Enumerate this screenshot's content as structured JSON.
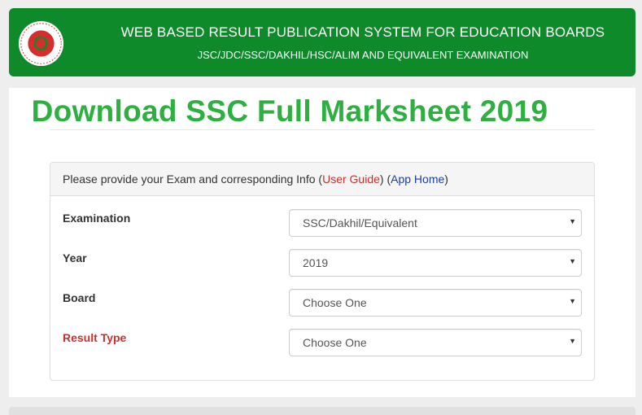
{
  "header": {
    "title": "WEB BASED RESULT PUBLICATION SYSTEM FOR EDUCATION BOARDS",
    "subtitle": "JSC/JDC/SSC/DAKHIL/HSC/ALIM AND EQUIVALENT EXAMINATION",
    "logo_icon": "government-seal-icon",
    "bg_color": "#0f8a2b"
  },
  "page": {
    "title": "Download SSC Full Marksheet 2019",
    "title_color": "#2db040"
  },
  "panel": {
    "intro": "Please provide your Exam and corresponding Info",
    "guide_paren_open": "(",
    "guide_link": "User Guide",
    "guide_paren_close": ")",
    "home_paren_open": "(",
    "home_link": "App Home",
    "home_paren_close": ")"
  },
  "form": {
    "examination": {
      "label": "Examination",
      "value": "SSC/Dakhil/Equivalent"
    },
    "year": {
      "label": "Year",
      "value": "2019"
    },
    "board": {
      "label": "Board",
      "value": "Choose One"
    },
    "result_type": {
      "label": "Result Type",
      "value": "Choose One"
    }
  },
  "icons": {
    "caret": "▼"
  }
}
